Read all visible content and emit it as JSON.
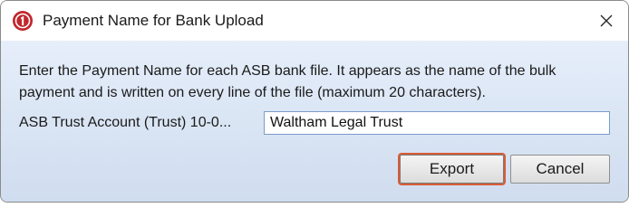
{
  "window": {
    "title": "Payment Name for Bank Upload",
    "app_icon": "app-logo-icon",
    "close_icon": "close-icon"
  },
  "dialog": {
    "instructions": "Enter the Payment Name for each ASB bank file. It appears as the name of the bulk payment and is written on every line of the file (maximum 20 characters).",
    "account_label": "ASB Trust Account (Trust) 10-0...",
    "payment_name_value": "Waltham Legal Trust"
  },
  "buttons": {
    "export_label": "Export",
    "cancel_label": "Cancel"
  },
  "colors": {
    "brand_icon": "#c1272d",
    "focus_ring": "#d95c36",
    "content_background": "#dde8f6"
  }
}
